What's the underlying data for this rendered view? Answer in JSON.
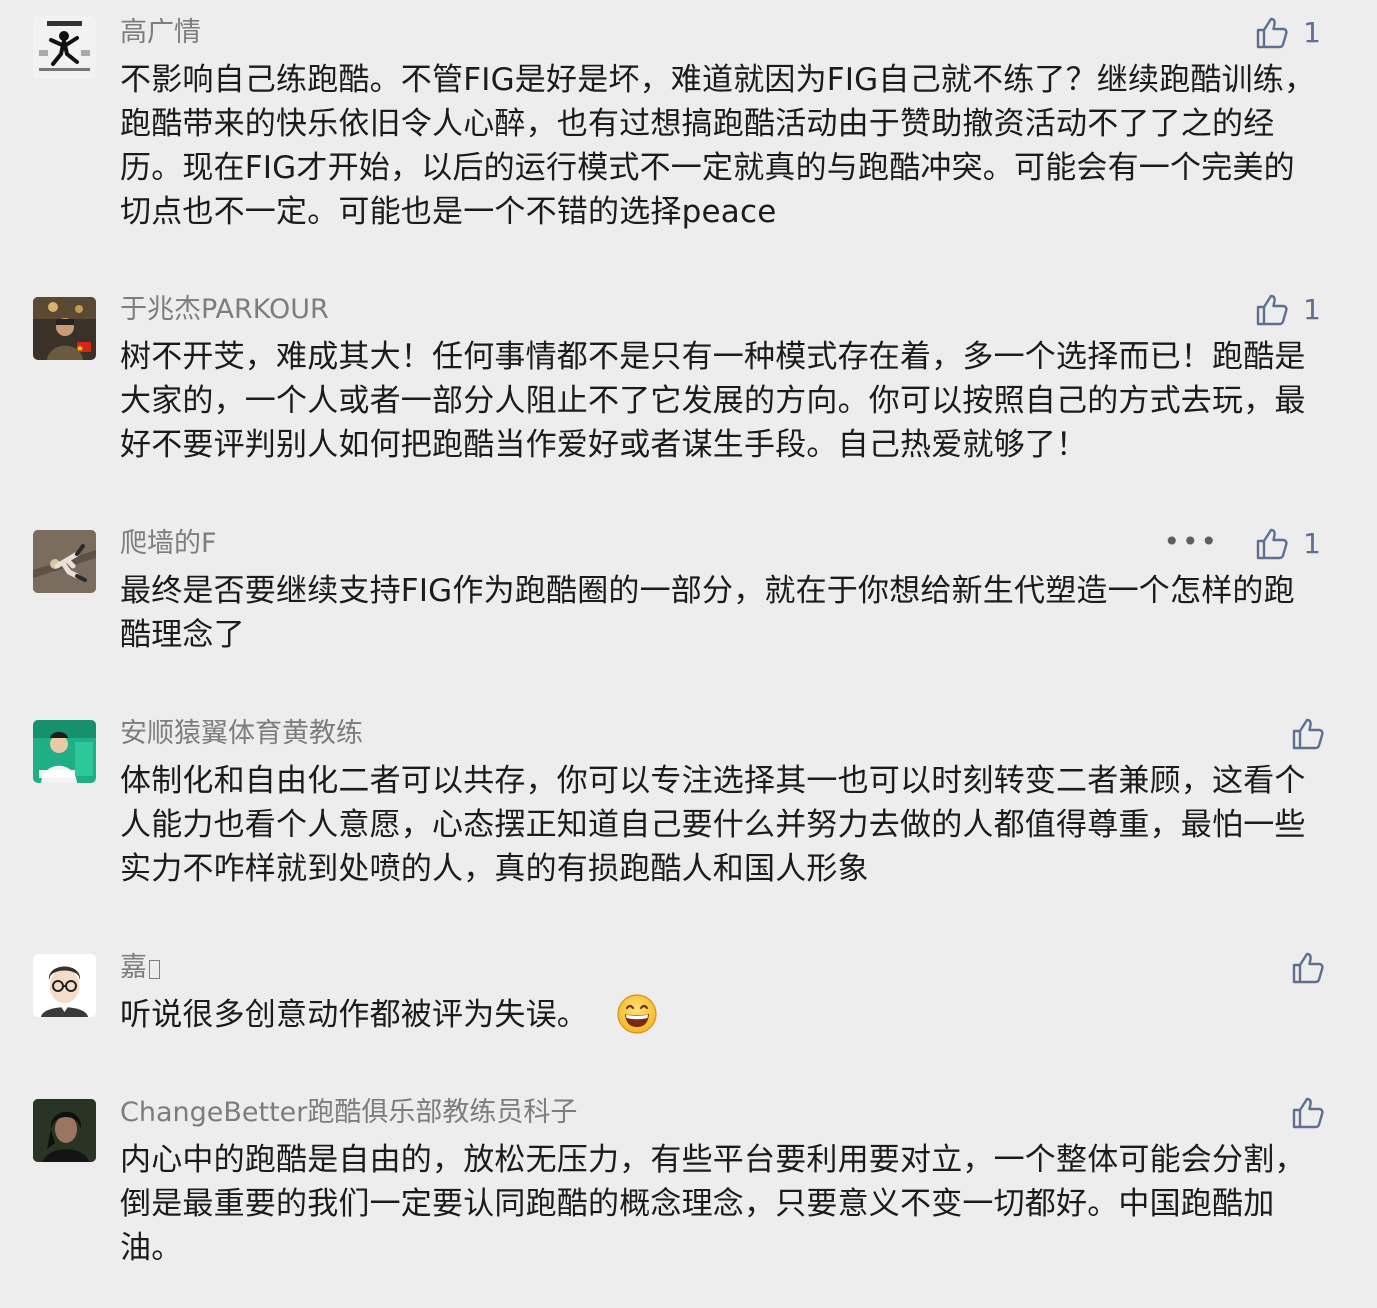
{
  "colors": {
    "background": "#ededed",
    "author": "#7d7d7d",
    "text": "#1b1b1b",
    "like": "#5e6f8f"
  },
  "icons": {
    "like": "thumbs-up-icon",
    "more": "more-dots-icon",
    "emoji": "grinning-face-emoji"
  },
  "comments": [
    {
      "author": "高广情",
      "text": "不影响自己练跑酷。不管FIG是好是坏，难道就因为FIG自己就不练了？继续跑酷训练，跑酷带来的快乐依旧令人心醉，也有过想搞跑酷活动由于赞助撤资活动不了了之的经历。现在FIG才开始，以后的运行模式不一定就真的与跑酷冲突。可能会有一个完美的切点也不一定。可能也是一个不错的选择peace",
      "likes": "1"
    },
    {
      "author": "于兆杰PARKOUR",
      "text": "树不开芠，难成其大！任何事情都不是只有一种模式存在着，多一个选择而已！跑酷是大家的，一个人或者一部分人阻止不了它发展的方向。你可以按照自己的方式去玩，最好不要评判别人如何把跑酷当作爱好或者谋生手段。自己热爱就够了！",
      "likes": "1"
    },
    {
      "author": "爬墙的F",
      "text": "最终是否要继续支持FIG作为跑酷圈的一部分，就在于你想给新生代塑造一个怎样的跑酷理念了",
      "likes": "1",
      "more": "•••"
    },
    {
      "author": "安顺猿翼体育黄教练",
      "text": "体制化和自由化二者可以共存，你可以专注选择其一也可以时刻转变二者兼顾，这看个人能力也看个人意愿，心态摆正知道自己要什么并努力去做的人都值得尊重，最怕一些实力不咋样就到处喷的人，真的有损跑酷人和国人形象",
      "likes": ""
    },
    {
      "author": "嘉",
      "text": "听说很多创意动作都被评为失误。",
      "likes": ""
    },
    {
      "author": "ChangeBetter跑酷俱乐部教练员科子",
      "text": "内心中的跑酷是自由的，放松无压力，有些平台要利用要对立，一个整体可能会分割，倒是最重要的我们一定要认同跑酷的概念理念，只要意义不变一切都好。中国跑酷加油。",
      "likes": ""
    }
  ]
}
